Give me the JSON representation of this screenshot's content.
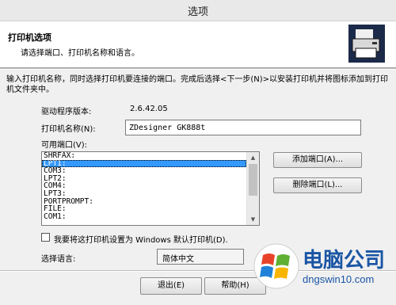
{
  "window": {
    "title": "选项"
  },
  "header": {
    "title": "打印机选项",
    "subtitle": "请选择端口、打印机名称和语言。",
    "icon": "printer-icon"
  },
  "description": "输入打印机名称，同时选择打印机要连接的端口。完成后选择<下一步(N)>以安装打印机并将图标添加到打印机文件夹中。",
  "driver": {
    "label": "驱动程序版本:",
    "value": "2.6.42.05"
  },
  "printer_name": {
    "label": "打印机名称(N):",
    "value": "ZDesigner GK888t"
  },
  "ports": {
    "label": "可用端口(V):",
    "items": [
      "SHRFAX:",
      "LPT1:",
      "COM3:",
      "LPT2:",
      "COM4:",
      "LPT3:",
      "PORTPROMPT:",
      "FILE:",
      "COM1:"
    ],
    "selected": "LPT1:"
  },
  "buttons": {
    "add_port": "添加端口(A)...",
    "delete_port": "删除端口(L)...",
    "exit": "退出(E)",
    "help": "帮助(H)"
  },
  "default_printer": {
    "label": "我要将这打印机设置为 Windows 默认打印机(D).",
    "checked": false
  },
  "language": {
    "label": "选择语言:",
    "value": "简体中文"
  },
  "watermark": {
    "title": "电脑公司",
    "url": "dngswin10.com"
  },
  "colors": {
    "selection": "#3399ff",
    "brand": "#1a55a4"
  }
}
